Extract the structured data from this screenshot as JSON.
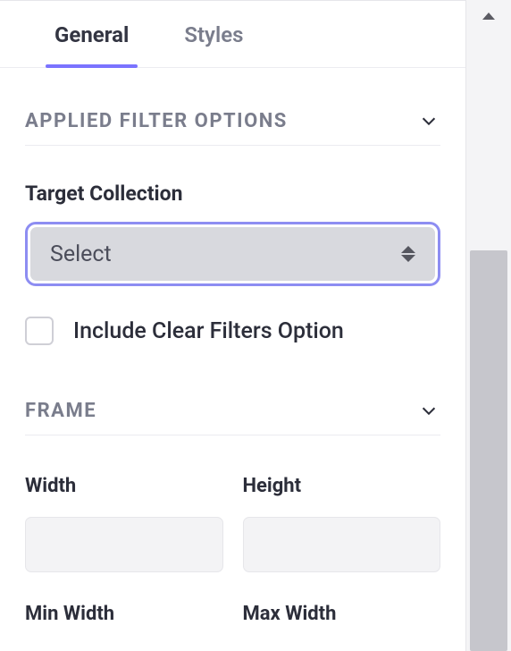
{
  "tabs": {
    "general": "General",
    "styles": "Styles"
  },
  "sections": {
    "filter": {
      "title": "APPLIED FILTER OPTIONS",
      "target_collection_label": "Target Collection",
      "target_collection_value": "Select",
      "include_clear_label": "Include Clear Filters Option"
    },
    "frame": {
      "title": "FRAME",
      "width_label": "Width",
      "height_label": "Height",
      "min_width_label": "Min Width",
      "max_width_label": "Max Width",
      "width_value": "",
      "height_value": ""
    }
  }
}
